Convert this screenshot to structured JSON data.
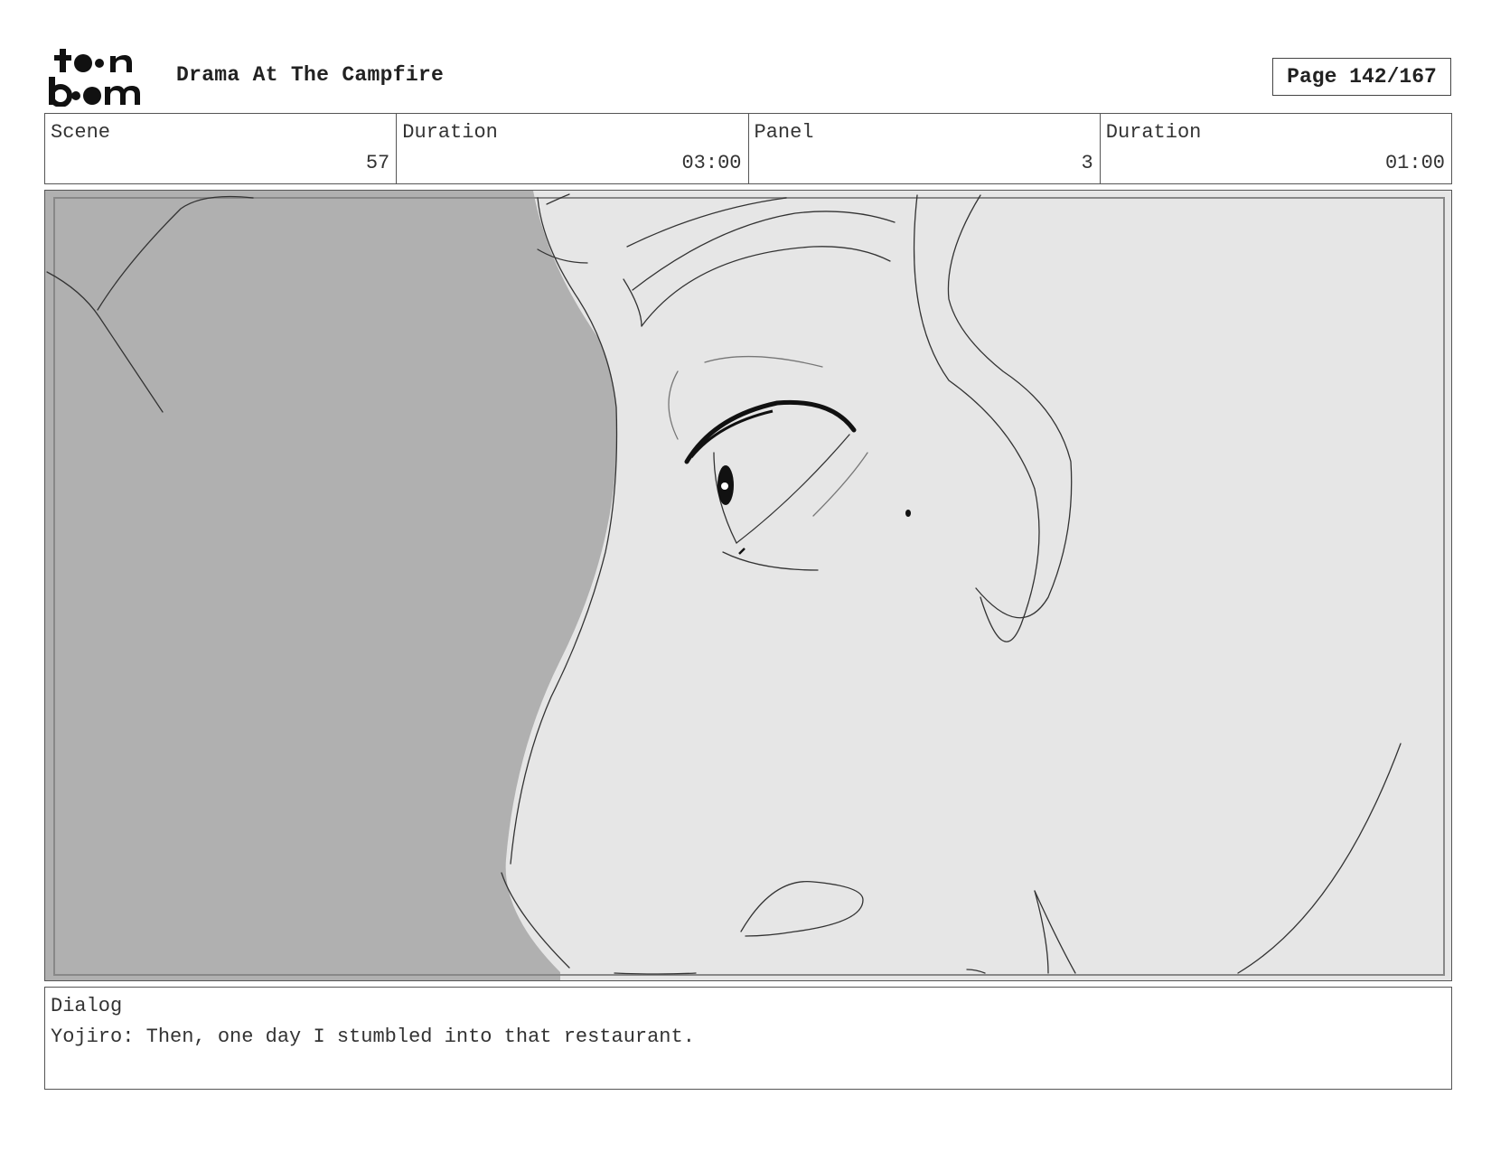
{
  "header": {
    "logo_text_line1": "toon",
    "logo_text_line2": "boom",
    "title": "Drama At The Campfire",
    "page_label": "Page 142/167"
  },
  "info": {
    "scene_label": "Scene",
    "scene_value": "57",
    "scene_duration_label": "Duration",
    "scene_duration_value": "03:00",
    "panel_label": "Panel",
    "panel_value": "3",
    "panel_duration_label": "Duration",
    "panel_duration_value": "01:00"
  },
  "panel": {
    "image_icon": "storyboard-sketch-closeup-face"
  },
  "dialog": {
    "label": "Dialog",
    "text": "Yojiro: Then, one day I stumbled into that restaurant."
  }
}
